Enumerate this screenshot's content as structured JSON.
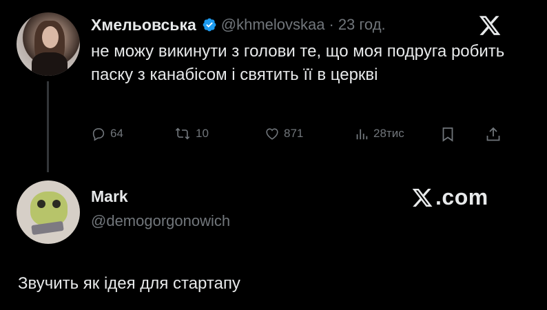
{
  "tweet": {
    "author_name": "Хмельовська",
    "handle": "@khmelovskaa",
    "separator": "·",
    "time": "23 год.",
    "text": "не можу викинути з голови те, що моя подруга робить паску з канабісом і святить її в церкві",
    "stats": {
      "replies": "64",
      "reposts": "10",
      "likes": "871",
      "views": "28тис"
    }
  },
  "reply": {
    "author_name": "Mark",
    "handle": "@demogorgonowich",
    "watermark": ".com",
    "text": "Звучить як ідея для стартапу"
  },
  "icons": {
    "verified": "verified-badge-icon",
    "platform": "x-logo-icon",
    "reply": "reply-icon",
    "repost": "repost-icon",
    "like": "heart-icon",
    "views": "views-icon",
    "bookmark": "bookmark-icon",
    "share": "share-icon"
  },
  "colors": {
    "background": "#000000",
    "text": "#e7e9ea",
    "secondary": "#71767b",
    "verified": "#1d9bf0"
  }
}
